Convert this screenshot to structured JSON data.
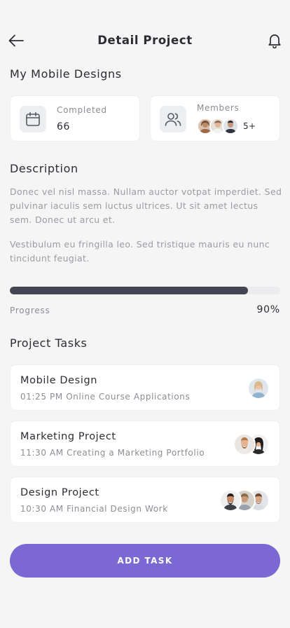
{
  "header": {
    "title": "Detail Project",
    "back_icon": "arrow-left-icon",
    "bell_icon": "bell-icon"
  },
  "project": {
    "name": "My Mobile Designs"
  },
  "stats": {
    "completed": {
      "label": "Completed",
      "value": "66",
      "icon": "calendar-icon"
    },
    "members": {
      "label": "Members",
      "more": "5+",
      "icon": "users-icon"
    }
  },
  "description": {
    "heading": "Description",
    "paragraphs": [
      "Donec vel nisl massa. Nullam auctor votpat imperdiet. Sed pulvinar iaculis sem luctus ultrices. Ut sit amet lectus sem. Donec ut arcu et.",
      "Vestibulum eu fringilla leo. Sed tristique mauris eu nunc tincidunt feugiat."
    ]
  },
  "progress": {
    "label": "Progress",
    "value_text": "90%",
    "fraction": 0.88
  },
  "tasks": {
    "heading": "Project Tasks",
    "items": [
      {
        "title": "Mobile Design",
        "subtitle": "01:25 PM Online Course Applications"
      },
      {
        "title": "Marketing Project",
        "subtitle": "11:30 AM Creating a Marketing Portfolio"
      },
      {
        "title": "Design Project",
        "subtitle": "10:30 AM Financial Design Work"
      }
    ]
  },
  "actions": {
    "add_task": "ADD TASK"
  },
  "colors": {
    "accent": "#7b68d3",
    "progress_fill": "#434652",
    "background": "#f5f5f6"
  }
}
